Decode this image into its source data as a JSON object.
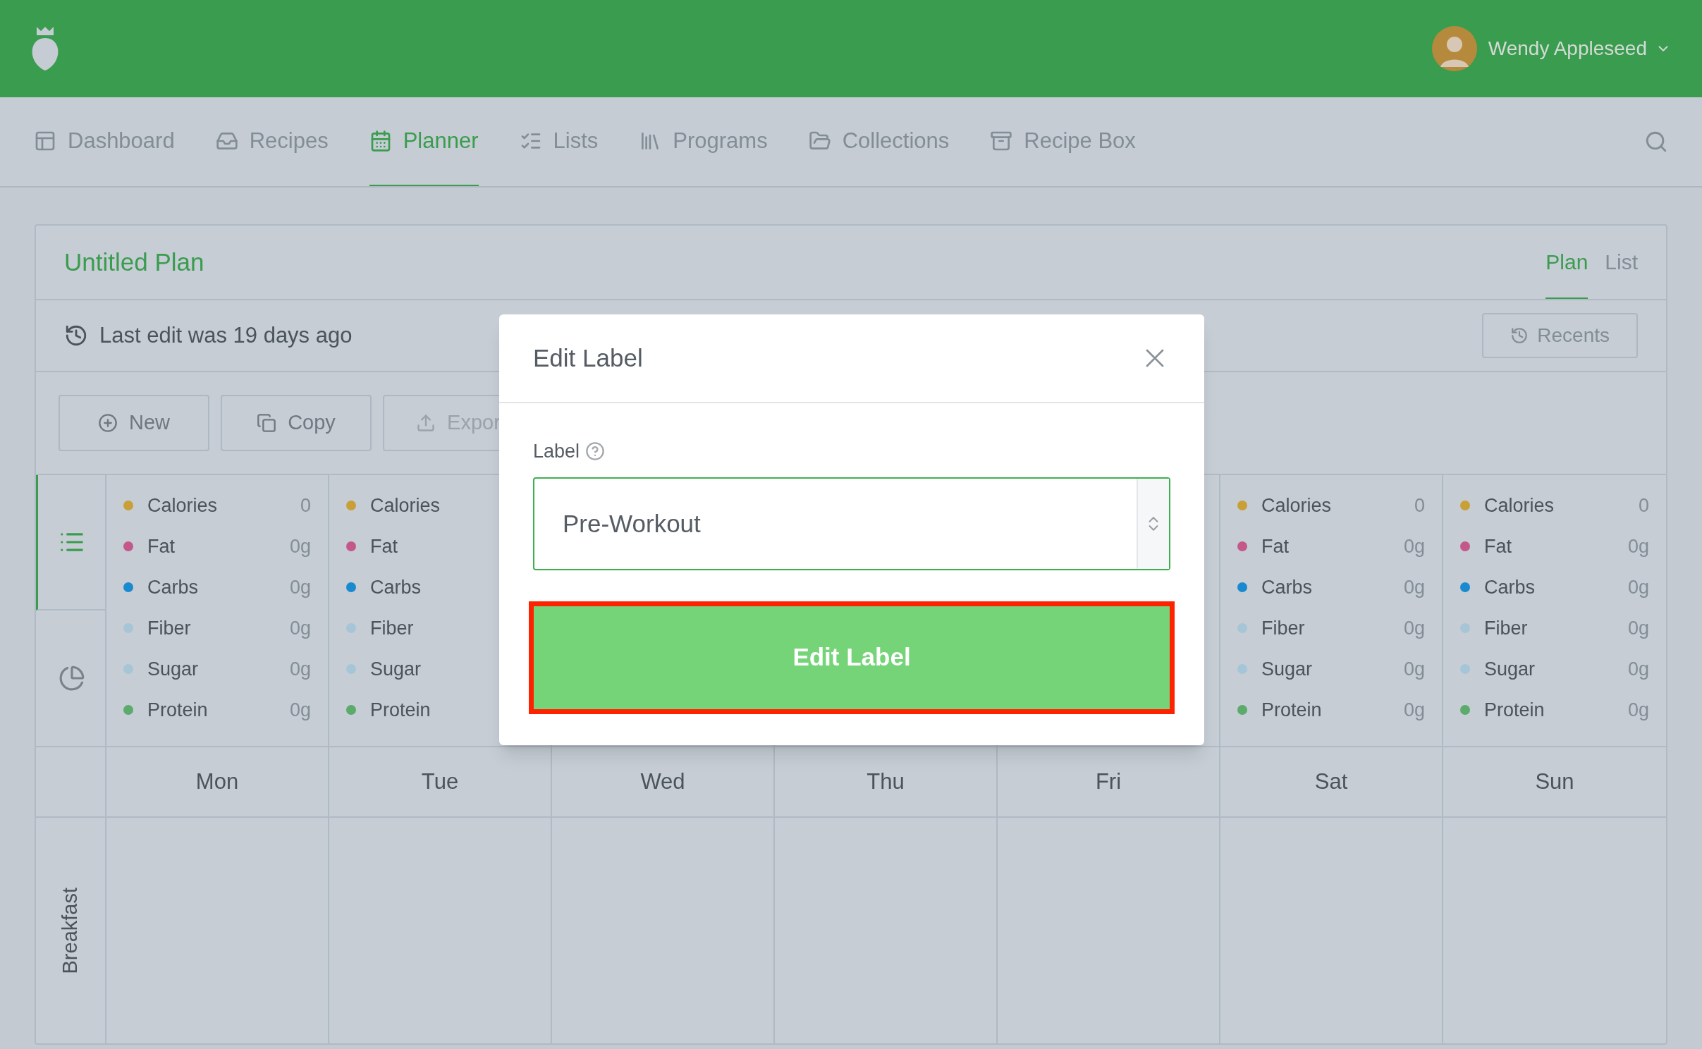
{
  "header": {
    "user_name": "Wendy Appleseed"
  },
  "nav": [
    {
      "label": "Dashboard",
      "selected": false
    },
    {
      "label": "Recipes",
      "selected": false
    },
    {
      "label": "Planner",
      "selected": true
    },
    {
      "label": "Lists",
      "selected": false
    },
    {
      "label": "Programs",
      "selected": false
    },
    {
      "label": "Collections",
      "selected": false
    },
    {
      "label": "Recipe Box",
      "selected": false
    }
  ],
  "plan": {
    "title": "Untitled Plan",
    "view_tabs": [
      {
        "label": "Plan",
        "selected": true
      },
      {
        "label": "List",
        "selected": false
      }
    ],
    "last_edit": "Last edit was 19 days ago",
    "recents_button": "Recents",
    "actions": [
      "New",
      "Copy",
      "Expor"
    ],
    "side_views": [
      {
        "kind": "list",
        "selected": true
      },
      {
        "kind": "pie",
        "selected": false
      }
    ],
    "nutrient_columns": [
      {
        "items": [
          {
            "name": "Calories",
            "value": "0",
            "color": "#c9a038"
          },
          {
            "name": "Fat",
            "value": "0g",
            "color": "#c4588a"
          },
          {
            "name": "Carbs",
            "value": "0g",
            "color": "#1a8ad0"
          },
          {
            "name": "Fiber",
            "value": "0g",
            "color": "#a6c6d8"
          },
          {
            "name": "Sugar",
            "value": "0g",
            "color": "#a6c6d8"
          },
          {
            "name": "Protein",
            "value": "0g",
            "color": "#5cab6c"
          }
        ]
      },
      {
        "items": [
          {
            "name": "Calories",
            "color": "#c9a038"
          },
          {
            "name": "Fat",
            "color": "#c4588a"
          },
          {
            "name": "Carbs",
            "color": "#1a8ad0"
          },
          {
            "name": "Fiber",
            "color": "#a6c6d8"
          },
          {
            "name": "Sugar",
            "color": "#a6c6d8"
          },
          {
            "name": "Protein",
            "color": "#5cab6c"
          }
        ]
      },
      {},
      {},
      {},
      {
        "items": [
          {
            "name": "Calories",
            "value": "0",
            "color": "#c9a038"
          },
          {
            "name": "Fat",
            "value": "0g",
            "color": "#c4588a"
          },
          {
            "name": "Carbs",
            "value": "0g",
            "color": "#1a8ad0"
          },
          {
            "name": "Fiber",
            "value": "0g",
            "color": "#a6c6d8"
          },
          {
            "name": "Sugar",
            "value": "0g",
            "color": "#a6c6d8"
          },
          {
            "name": "Protein",
            "value": "0g",
            "color": "#5cab6c"
          }
        ]
      },
      {
        "items": [
          {
            "name": "Calories",
            "value": "0",
            "color": "#c9a038"
          },
          {
            "name": "Fat",
            "value": "0g",
            "color": "#c4588a"
          },
          {
            "name": "Carbs",
            "value": "0g",
            "color": "#1a8ad0"
          },
          {
            "name": "Fiber",
            "value": "0g",
            "color": "#a6c6d8"
          },
          {
            "name": "Sugar",
            "value": "0g",
            "color": "#a6c6d8"
          },
          {
            "name": "Protein",
            "value": "0g",
            "color": "#5cab6c"
          }
        ]
      }
    ],
    "days": [
      "Mon",
      "Tue",
      "Wed",
      "Thu",
      "Fri",
      "Sat",
      "Sun"
    ],
    "meals": [
      "Breakfast"
    ]
  },
  "modal": {
    "title": "Edit Label",
    "field_label": "Label",
    "field_value": "Pre-Workout",
    "submit_button": "Edit Label",
    "submit_highlighted": true
  }
}
